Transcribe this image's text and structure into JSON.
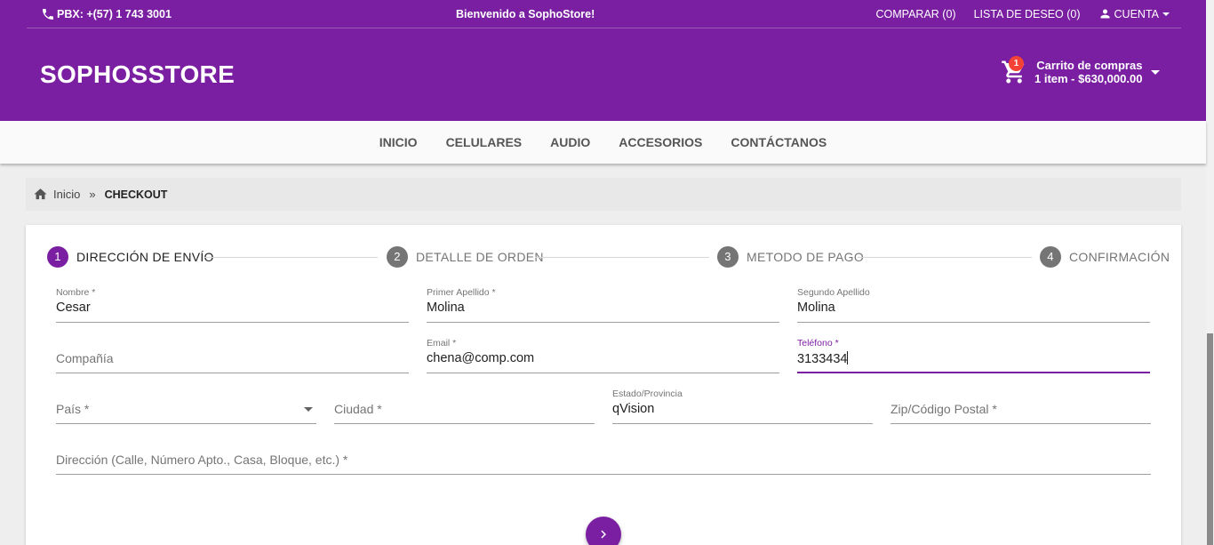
{
  "topbar": {
    "phone": "PBX: +(57) 1 743 3001",
    "welcome": "Bienvenido a SophoStore!",
    "compare": "COMPARAR (0)",
    "wishlist": "LISTA DE DESEO (0)",
    "account": "CUENTA"
  },
  "brand": {
    "logo": "SOPHOSSTORE"
  },
  "cart": {
    "count": "1",
    "title": "Carrito de compras",
    "summary": "1 item - $630,000.00"
  },
  "nav": {
    "items": [
      "INICIO",
      "CELULARES",
      "AUDIO",
      "ACCESORIOS",
      "CONTÁCTANOS"
    ]
  },
  "breadcrumb": {
    "home": "Inicio",
    "separator": "»",
    "current": "CHECKOUT"
  },
  "steps": [
    {
      "num": "1",
      "label": "DIRECCIÓN DE ENVÍO"
    },
    {
      "num": "2",
      "label": "DETALLE DE ORDEN"
    },
    {
      "num": "3",
      "label": "METODO DE PAGO"
    },
    {
      "num": "4",
      "label": "CONFIRMACIÓN"
    }
  ],
  "form": {
    "nombre": {
      "label": "Nombre *",
      "value": "Cesar"
    },
    "apellido1": {
      "label": "Primer Apellido *",
      "value": "Molina"
    },
    "apellido2": {
      "label": "Segundo Apellido",
      "value": "Molina"
    },
    "compania": {
      "placeholder": "Compañía"
    },
    "email": {
      "label": "Email *",
      "value": "chena@comp.com"
    },
    "telefono": {
      "label": "Teléfono *",
      "value": "3133434"
    },
    "pais": {
      "placeholder": "País *"
    },
    "ciudad": {
      "placeholder": "Ciudad *"
    },
    "estado": {
      "label": "Estado/Provincia",
      "value": "qVision"
    },
    "zip": {
      "placeholder": "Zip/Código Postal *"
    },
    "direccion": {
      "placeholder": "Dirección (Calle, Número Apto., Casa, Bloque, etc.) *"
    }
  },
  "colors": {
    "primary": "#7b1fa2",
    "badge": "#f44336",
    "inactive_step": "#757575"
  }
}
